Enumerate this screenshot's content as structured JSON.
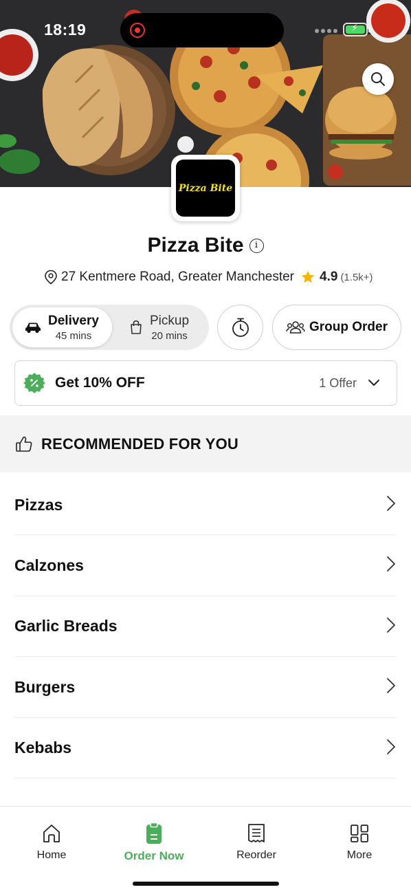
{
  "status_bar": {
    "time": "18:19"
  },
  "hero": {
    "search_icon": "search-icon"
  },
  "restaurant": {
    "logo_text": "Pizza Bite",
    "name": "Pizza Bite",
    "address": "27 Kentmere Road, Greater Manchester",
    "rating": "4.9",
    "rating_count": "(1.5k+)"
  },
  "order_mode": {
    "delivery": {
      "label": "Delivery",
      "time": "45 mins"
    },
    "pickup": {
      "label": "Pickup",
      "time": "20 mins"
    },
    "group_order_label": "Group Order"
  },
  "offer": {
    "title": "Get 10% OFF",
    "count": "1 Offer"
  },
  "recommended": {
    "title": "RECOMMENDED FOR YOU"
  },
  "categories": [
    {
      "label": "Pizzas"
    },
    {
      "label": "Calzones"
    },
    {
      "label": "Garlic Breads"
    },
    {
      "label": "Burgers"
    },
    {
      "label": "Kebabs"
    }
  ],
  "tabbar": {
    "home": "Home",
    "order_now": "Order Now",
    "reorder": "Reorder",
    "more": "More"
  },
  "colors": {
    "accent_green": "#4cae5a",
    "star": "#f5b400",
    "record_red": "#e33333"
  }
}
